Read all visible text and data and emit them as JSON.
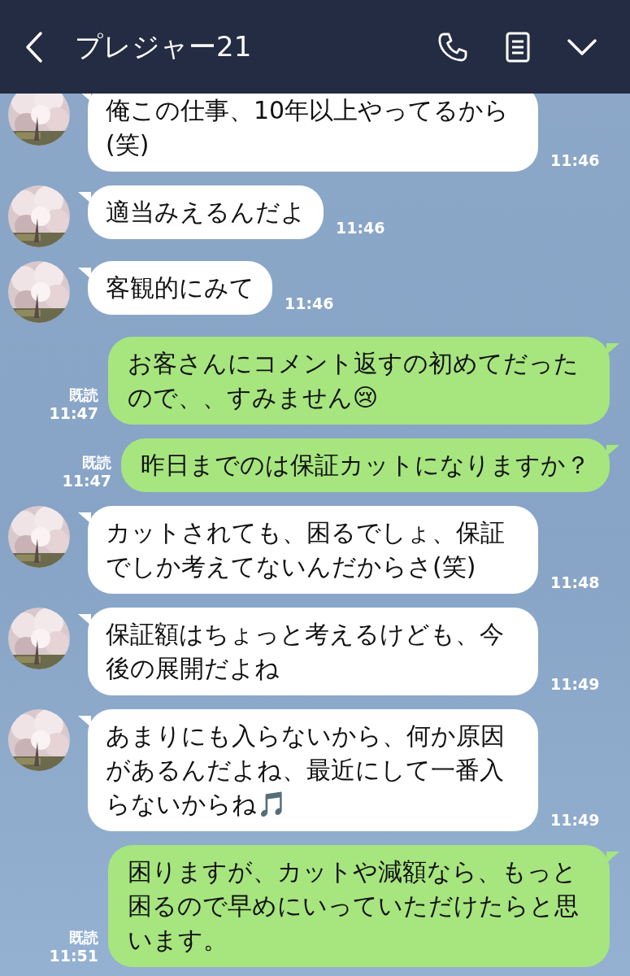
{
  "header": {
    "title": "プレジャー21"
  },
  "messages": [
    {
      "kind": "received",
      "text": "俺この仕事、10年以上やってるから(笑)",
      "time": "11:46"
    },
    {
      "kind": "received",
      "text": "適当みえるんだよ",
      "time": "11:46"
    },
    {
      "kind": "received",
      "text": "客観的にみて",
      "time": "11:46"
    },
    {
      "kind": "sent",
      "text": "お客さんにコメント返すの初めてだったので、、すみません😢",
      "time": "11:47",
      "read_label": "既読"
    },
    {
      "kind": "sent",
      "text": "昨日までのは保証カットになりますか？",
      "time": "11:47",
      "read_label": "既読"
    },
    {
      "kind": "received",
      "text": "カットされても、困るでしょ、保証でしか考えてないんだからさ(笑)",
      "time": "11:48"
    },
    {
      "kind": "received",
      "text": "保証額はちょっと考えるけども、今後の展開だよね",
      "time": "11:49"
    },
    {
      "kind": "received",
      "text": "あまりにも入らないから、何か原因があるんだよね、最近にして一番入らないからね🎵",
      "time": "11:49"
    },
    {
      "kind": "sent",
      "text": "困りますが、カットや減額なら、もっと困るので早めにいっていただけたらと思います。",
      "time": "11:51",
      "read_label": "既読"
    }
  ]
}
